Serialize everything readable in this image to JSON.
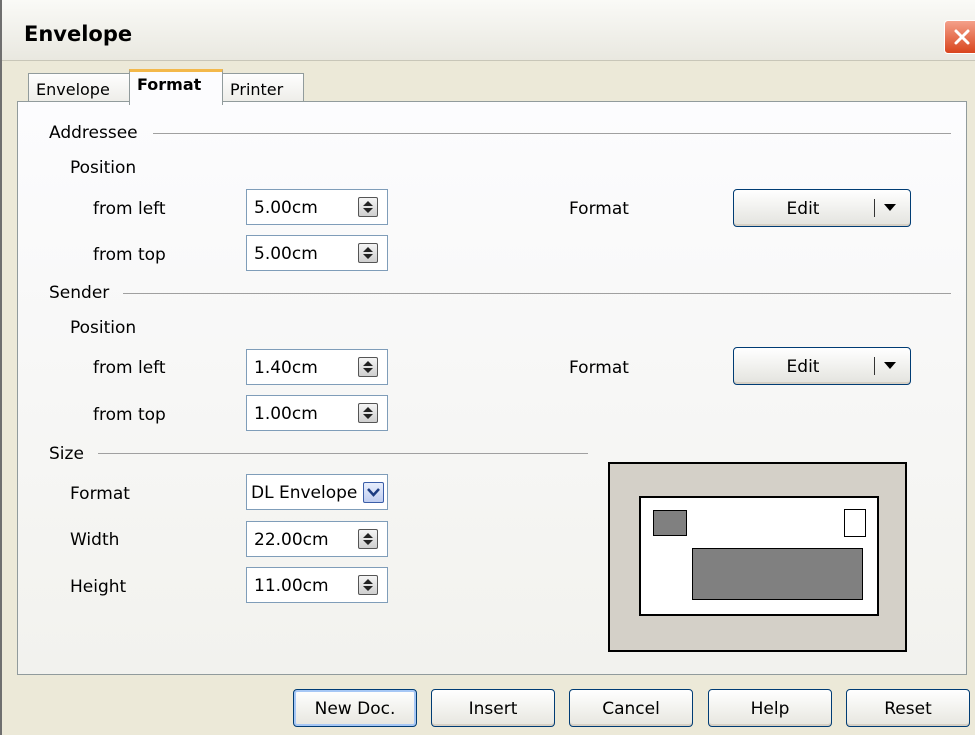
{
  "window": {
    "title": "Envelope",
    "close_icon": "close-icon"
  },
  "tabs": [
    {
      "label": "Envelope",
      "active": false
    },
    {
      "label": "Format",
      "active": true
    },
    {
      "label": "Printer",
      "active": false
    }
  ],
  "addressee": {
    "section_label": "Addressee",
    "position_label": "Position",
    "from_left_label": "from left",
    "from_left_value": "5.00cm",
    "from_top_label": "from top",
    "from_top_value": "5.00cm",
    "format_label": "Format",
    "edit_label": "Edit"
  },
  "sender": {
    "section_label": "Sender",
    "position_label": "Position",
    "from_left_label": "from left",
    "from_left_value": "1.40cm",
    "from_top_label": "from top",
    "from_top_value": "1.00cm",
    "format_label": "Format",
    "edit_label": "Edit"
  },
  "size": {
    "section_label": "Size",
    "format_label": "Format",
    "format_value": "DL Envelope",
    "width_label": "Width",
    "width_value": "22.00cm",
    "height_label": "Height",
    "height_value": "11.00cm"
  },
  "buttons": {
    "new_doc": "New Doc.",
    "insert": "Insert",
    "cancel": "Cancel",
    "help": "Help",
    "reset": "Reset"
  },
  "colors": {
    "accent_tab": "#f3b84a",
    "preview_block": "#808080",
    "close_button": "#d9451d"
  }
}
